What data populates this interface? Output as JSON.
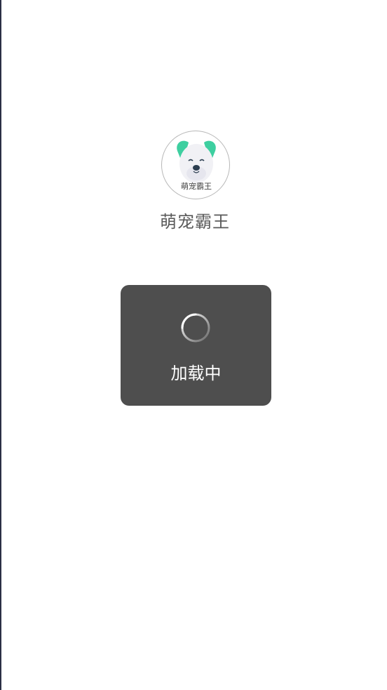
{
  "splash": {
    "logo_caption": "萌宠霸王",
    "app_name": "萌宠霸王",
    "icon": "dog-mascot-icon",
    "colors": {
      "ear": "#3ecfa0",
      "face": "#f1f1f5",
      "nose": "#2c3e50"
    }
  },
  "loading_toast": {
    "label": "加载中",
    "icon": "loading-spinner-icon",
    "background": "#4e4e4e"
  }
}
